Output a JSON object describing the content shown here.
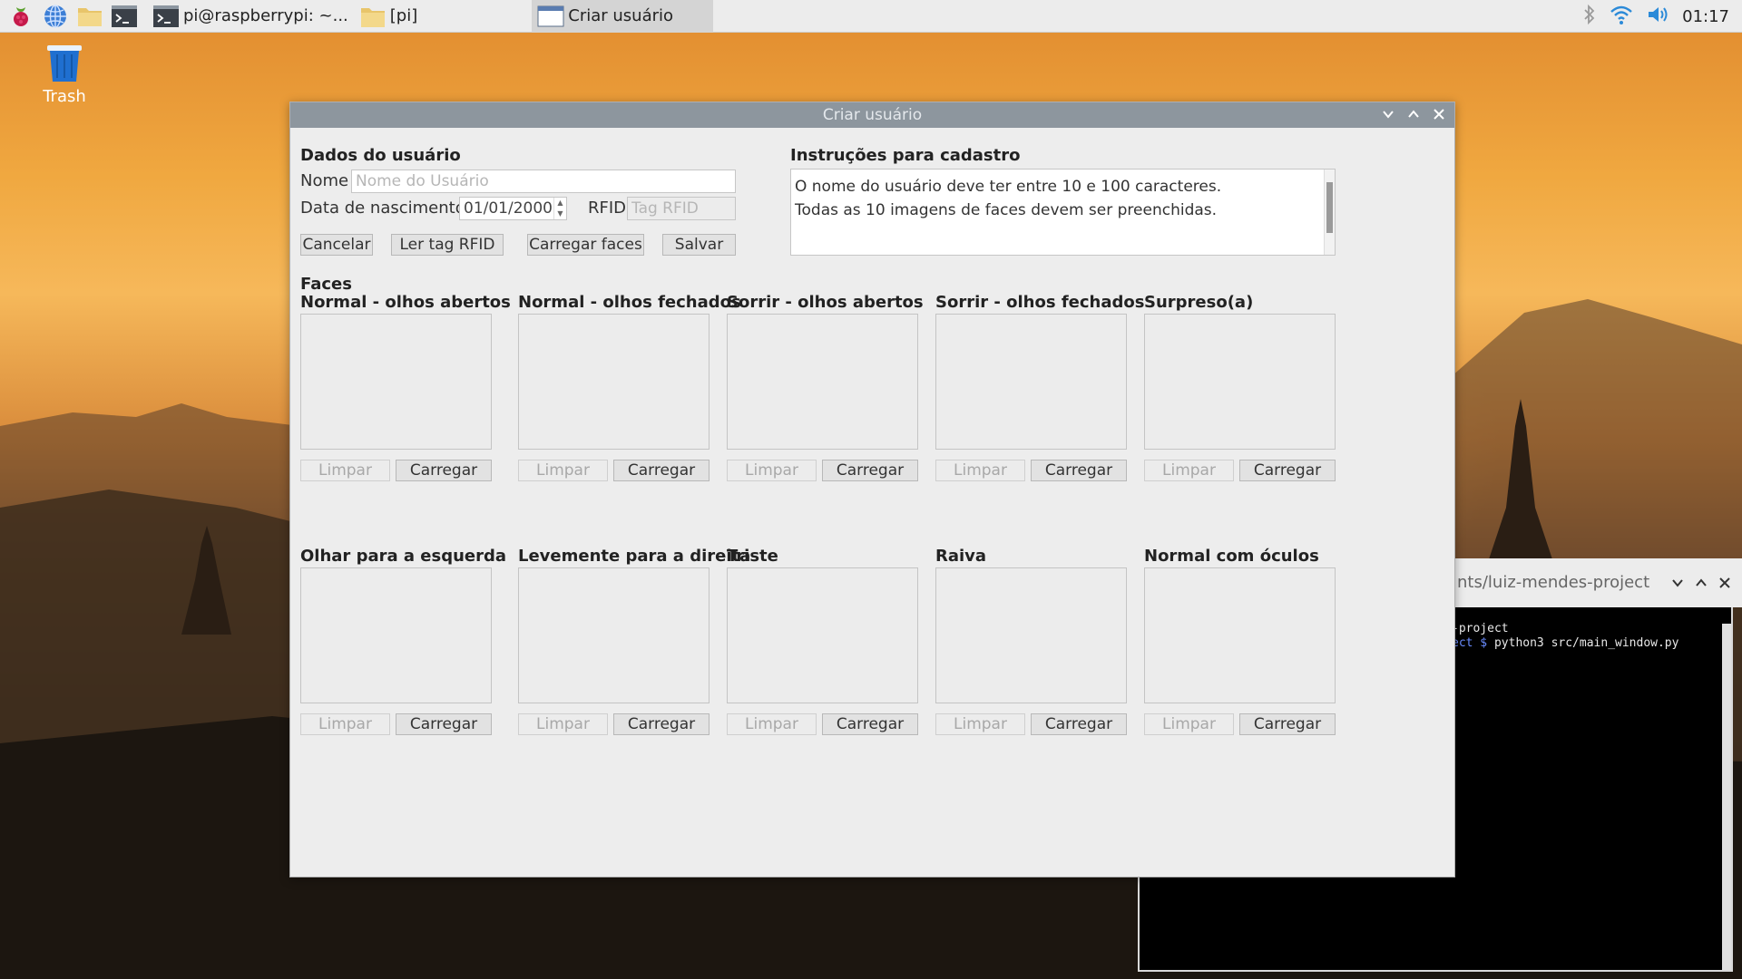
{
  "taskbar": {
    "tasks": [
      {
        "label": "pi@raspberrypi: ~..."
      },
      {
        "label": "[pi]"
      },
      {
        "label": "Criar usuário"
      }
    ],
    "clock": "01:17"
  },
  "desktop": {
    "trash_label": "Trash"
  },
  "terminal": {
    "title": "nts/luiz-mendes-project",
    "line1": "-project",
    "line2_prompt": "ect $",
    "line2_cmd": " python3 src/main_window.py"
  },
  "dialog": {
    "title": "Criar usuário",
    "user_section": "Dados do usuário",
    "name_label": "Nome",
    "name_placeholder": "Nome do Usuário",
    "birth_label": "Data de nascimento",
    "birth_value": "01/01/2000",
    "rfid_label": "RFID",
    "rfid_placeholder": "Tag RFID",
    "buttons": {
      "cancel": "Cancelar",
      "read_rfid": "Ler tag RFID",
      "load_faces": "Carregar faces",
      "save": "Salvar"
    },
    "instructions_title": "Instruções para cadastro",
    "instructions": [
      "O nome do usuário deve ter entre 10 e 100 caracteres.",
      "Todas as 10 imagens de faces devem ser preenchidas."
    ],
    "faces_title": "Faces",
    "clear_label": "Limpar",
    "load_label": "Carregar",
    "faces": [
      {
        "label": "Normal - olhos abertos"
      },
      {
        "label": "Normal - olhos fechados"
      },
      {
        "label": "Sorrir - olhos abertos"
      },
      {
        "label": "Sorrir - olhos fechados"
      },
      {
        "label": "Surpreso(a)"
      },
      {
        "label": "Olhar para a esquerda"
      },
      {
        "label": "Levemente para a direita"
      },
      {
        "label": "Triste"
      },
      {
        "label": "Raiva"
      },
      {
        "label": "Normal com óculos"
      }
    ]
  }
}
